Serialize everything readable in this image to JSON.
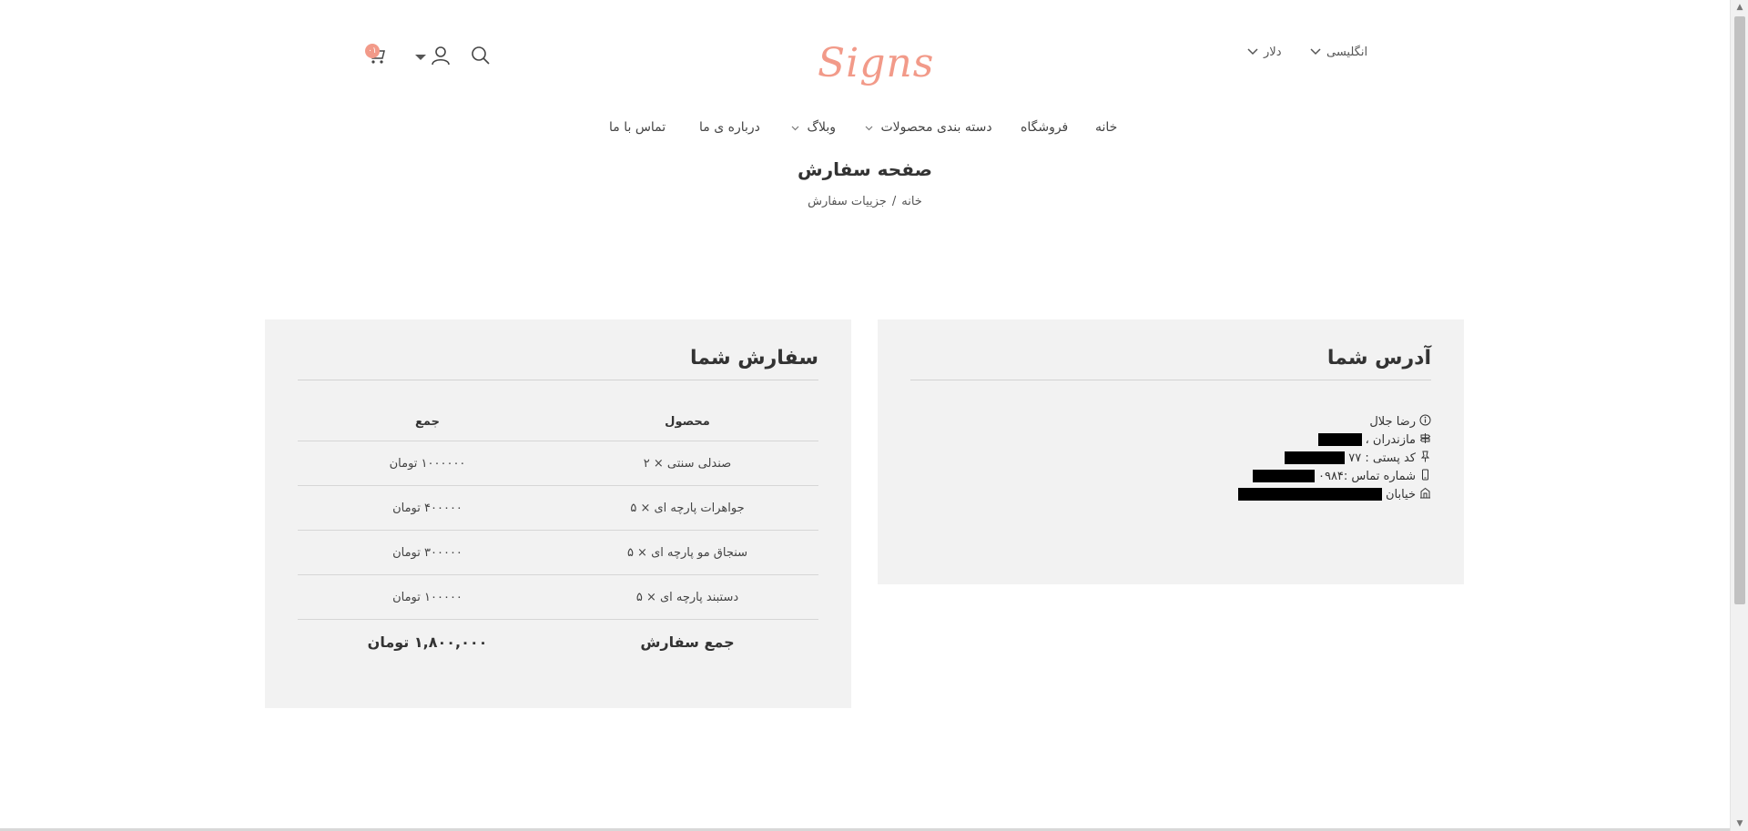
{
  "header": {
    "logo": "Signs",
    "language": "انگلیسی",
    "currency": "دلار",
    "cart_count": "۰۱"
  },
  "nav": {
    "items": [
      {
        "label": "خانه"
      },
      {
        "label": "فروشگاه"
      },
      {
        "label": "دسته بندی محصولات"
      },
      {
        "label": "وبلاگ"
      },
      {
        "label": "درباره ی ما"
      },
      {
        "label": "تماس با ما"
      }
    ]
  },
  "page": {
    "title": "صفحه سفارش",
    "breadcrumb_home": "خانه",
    "breadcrumb_sep": "/",
    "breadcrumb_current": "جزییات سفارش"
  },
  "order": {
    "title": "سفارش شما",
    "col_product": "محصول",
    "col_total": "جمع",
    "rows": [
      {
        "product": "صندلی سنتی × ۲",
        "total": "۱۰۰۰۰۰۰ تومان"
      },
      {
        "product": "جواهرات پارچه ای × ۵",
        "total": "۴۰۰۰۰۰ تومان"
      },
      {
        "product": "سنجاق مو پارچه ای × ۵",
        "total": "۳۰۰۰۰۰ تومان"
      },
      {
        "product": "دستبند پارچه ای × ۵",
        "total": "۱۰۰۰۰۰ تومان"
      }
    ],
    "grand_label": "جمع سفارش",
    "grand_total": "۱,۸۰۰,۰۰۰ تومان"
  },
  "address": {
    "title": "آدرس شما",
    "name": "رضا جلال",
    "province": "مازندران ،",
    "postal_label": "کد پستی : ۷۷",
    "phone_label": "شماره تماس :۰۹۸۴",
    "street_label": "خیابان"
  },
  "colors": {
    "brand": "#f29a89",
    "panel_bg": "#f2f2f2"
  }
}
